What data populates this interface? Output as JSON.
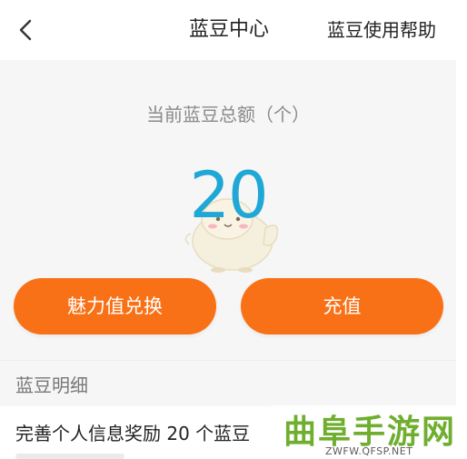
{
  "header": {
    "title": "蓝豆中心",
    "help_label": "蓝豆使用帮助",
    "back_icon": "chevron-left-icon"
  },
  "summary": {
    "label": "当前蓝豆总额（个）",
    "amount": "20",
    "amount_color": "#1fa7d6"
  },
  "actions": {
    "charm_exchange_label": "魅力值兑换",
    "recharge_label": "充值",
    "button_color": "#f97116"
  },
  "details": {
    "section_label": "蓝豆明细",
    "items": [
      {
        "title": "完善个人信息奖励 20 个蓝豆"
      }
    ]
  },
  "watermark": {
    "text": "曲阜手游网",
    "url": "ZWFW.QFSP.NET"
  }
}
